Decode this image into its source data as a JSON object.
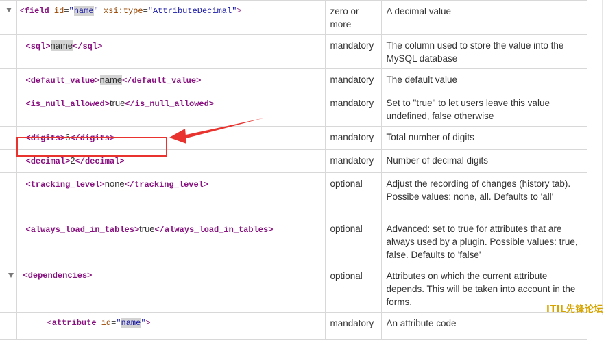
{
  "rows": [
    {
      "obligation": "zero or more",
      "description": "A decimal value"
    },
    {
      "obligation": "mandatory",
      "description": "The column used to store the value into the MySQL database"
    },
    {
      "obligation": "mandatory",
      "description": "The default value"
    },
    {
      "obligation": "mandatory",
      "description": "Set to \"true\" to let users leave this value undefined, false otherwise"
    },
    {
      "obligation": "mandatory",
      "description": "Total number of digits"
    },
    {
      "obligation": "mandatory",
      "description": "Number of decimal digits"
    },
    {
      "obligation": "optional",
      "description": "Adjust the recording of changes (history tab). Possibe values: none, all. Defaults to 'all'"
    },
    {
      "obligation": "optional",
      "description": "Advanced: set to true for attributes that are always used by a plugin. Possible values: true, false. Defaults to 'false'"
    },
    {
      "obligation": "optional",
      "description": "Attributes on which the current attribute depends. This will be taken into account in the forms."
    },
    {
      "obligation": "mandatory",
      "description": "An attribute code"
    }
  ],
  "code": {
    "field_tag": "field",
    "field_attr_id": "id",
    "field_attr_id_val": "name",
    "field_attr_type": "xsi:type",
    "field_attr_type_val": "AttributeDecimal",
    "sql_tag": "sql",
    "sql_val": "name",
    "default_tag": "default_value",
    "default_val": "name",
    "null_tag": "is_null_allowed",
    "null_val": "true",
    "digits_tag": "digits",
    "digits_val": "6",
    "decimal_tag": "decimal",
    "decimal_val": "2",
    "tracking_tag": "tracking_level",
    "tracking_val": "none",
    "always_tag": "always_load_in_tables",
    "always_val": "true",
    "deps_tag": "dependencies",
    "attr_tag": "attribute",
    "attr_id": "id",
    "attr_id_val": "name"
  },
  "watermark": "ITIL先锋论坛",
  "colors": {
    "tag": "#881280",
    "attr_name": "#994500",
    "attr_value": "#1a1aa6",
    "highlight": "#d3d3d3",
    "annotation": "#e8332e",
    "watermark": "#d6a400"
  },
  "icons": [
    "collapse-triangle-icon",
    "annotation-arrow"
  ]
}
